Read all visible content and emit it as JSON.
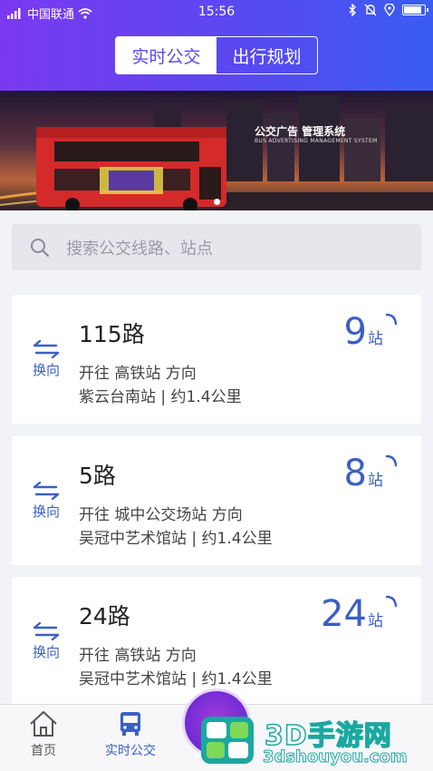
{
  "status_bar": {
    "carrier": "中国联通",
    "time": "15:56"
  },
  "segment": {
    "tabs": [
      "实时公交",
      "出行规划"
    ],
    "active_index": 0
  },
  "banner": {
    "title": "公交广告 管理系统",
    "subtitle": "BUS ADVERTISING MANAGEMENT SYSTEM",
    "slide_count": 2,
    "active_slide": 1
  },
  "search": {
    "placeholder": "搜索公交线路、站点"
  },
  "routes": [
    {
      "swap_label": "换向",
      "name": "115路",
      "direction": "开往 高铁站 方向",
      "stop": "紫云台南站 | 约1.4公里",
      "eta_num": "9",
      "eta_unit": "站"
    },
    {
      "swap_label": "换向",
      "name": "5路",
      "direction": "开往 城中公交场站 方向",
      "stop": "吴冠中艺术馆站 | 约1.4公里",
      "eta_num": "8",
      "eta_unit": "站"
    },
    {
      "swap_label": "换向",
      "name": "24路",
      "direction": "开往 高铁站 方向",
      "stop": "吴冠中艺术馆站 | 约1.4公里",
      "eta_num": "24",
      "eta_unit": "站"
    }
  ],
  "bottom_nav": {
    "items": [
      {
        "label": "首页",
        "icon": "home-icon"
      },
      {
        "label": "实时公交",
        "icon": "bus-icon"
      }
    ],
    "active_index": 1
  },
  "watermark": {
    "brand": "3D手游网",
    "url": "3dshouyou.com"
  },
  "colors": {
    "accent": "#3b5fc4",
    "header_start": "#7b39f0",
    "header_end": "#3a5cf2"
  }
}
